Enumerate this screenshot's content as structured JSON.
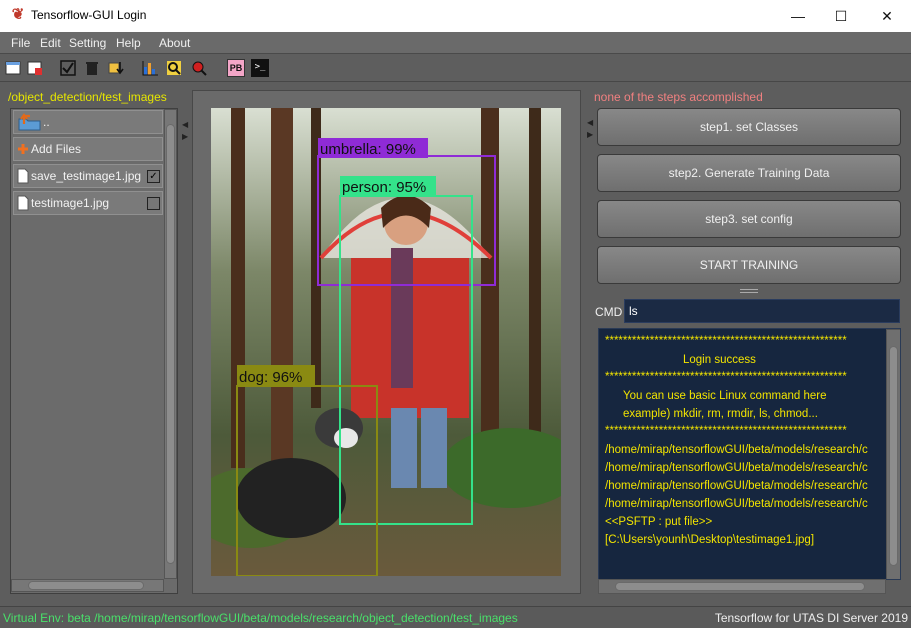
{
  "window": {
    "title": "Tensorflow-GUI Login",
    "controls": {
      "minimize": "—",
      "maximize": "☐",
      "close": "✕"
    }
  },
  "menu": [
    "File",
    "Edit",
    "Setting",
    "Help",
    "About"
  ],
  "toolbar": {
    "icons": [
      "new-file-icon",
      "close-file-icon",
      "check-icon",
      "trash-icon",
      "import-icon",
      "chart-icon",
      "inspect-icon",
      "record-icon",
      "pb-icon",
      "terminal-icon"
    ],
    "pb_label": "PB",
    "terminal_label": ">_"
  },
  "left_panel": {
    "path": "/object_detection/test_images",
    "items": [
      {
        "label": "..",
        "type": "up-folder"
      },
      {
        "label": "Add Files",
        "type": "add"
      },
      {
        "label": "save_testimage1.jpg",
        "checked": true,
        "check_mark": "✓"
      },
      {
        "label": "testimage1.jpg",
        "checked": false,
        "check_mark": ""
      }
    ]
  },
  "image": {
    "detections": [
      {
        "label": "umbrella: 99%",
        "color": "#8f2bd6"
      },
      {
        "label": "person: 95%",
        "color": "#34e28a"
      },
      {
        "label": "dog: 96%",
        "color": "#8a8a12"
      }
    ]
  },
  "right_panel": {
    "status": "none of the steps accomplished",
    "steps": [
      "step1. set Classes",
      "step2. Generate Training Data",
      "step3. set config",
      "START TRAINING"
    ],
    "cmd_label": "CMD",
    "cmd_value": "ls",
    "console": [
      "******************************************************",
      "                 Login success",
      "******************************************************",
      "      You can use basic Linux command here",
      "      example) mkdir, rm, rmdir, ls, chmod...",
      "******************************************************",
      "/home/mirap/tensorflowGUI/beta/models/research/c",
      "/home/mirap/tensorflowGUI/beta/models/research/c",
      "/home/mirap/tensorflowGUI/beta/models/research/c",
      "/home/mirap/tensorflowGUI/beta/models/research/c",
      "<<PSFTP : put file>>",
      "[C:\\Users\\younh\\Desktop\\testimage1.jpg]"
    ]
  },
  "statusbar": {
    "left": "Virtual Env: beta /home/mirap/tensorflowGUI/beta/models/research/object_detection/test_images",
    "right": "Tensorflow for UTAS DI Server 2019"
  },
  "colors": {
    "path": "#e6e600",
    "status_warning": "#f08080",
    "console_text": "#f2e400",
    "statusbar_left": "#49e06a"
  }
}
